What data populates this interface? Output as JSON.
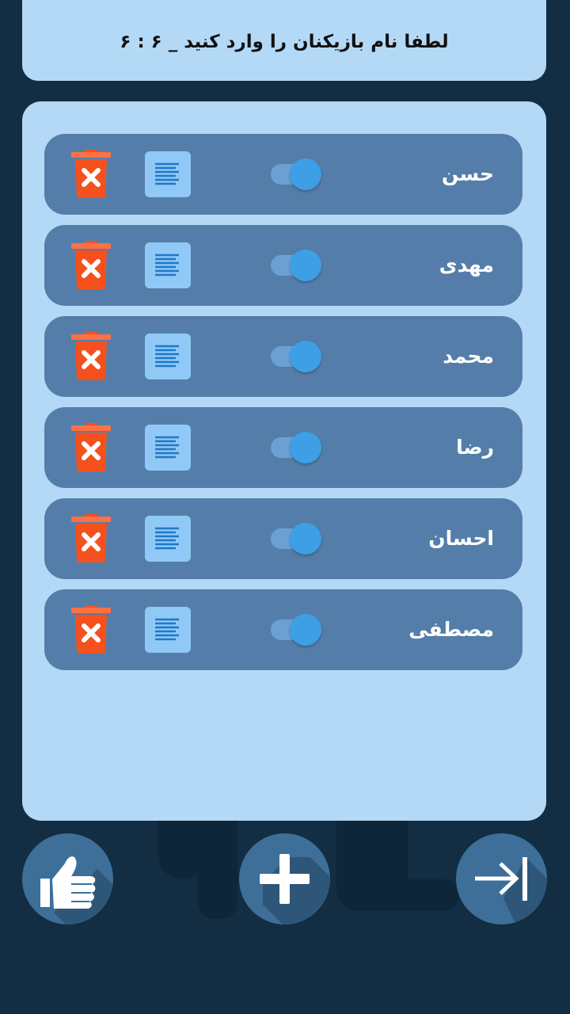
{
  "header": {
    "title": "لطفا نام بازیکنان را وارد کنید _ ۶ : ۶"
  },
  "players": [
    {
      "name": "حسن",
      "enabled": true
    },
    {
      "name": "مهدی",
      "enabled": true
    },
    {
      "name": "محمد",
      "enabled": true
    },
    {
      "name": "رضا",
      "enabled": true
    },
    {
      "name": "احسان",
      "enabled": true
    },
    {
      "name": "مصطفی",
      "enabled": true
    }
  ],
  "row_icons": {
    "toggle": "toggle-switch",
    "edit": "document-lines-icon",
    "delete": "trash-can-x-icon"
  },
  "bottom_bar": {
    "left": "thumbs-up-icon",
    "center": "plus-icon",
    "right": "arrow-to-bar-icon"
  },
  "colors": {
    "background": "#132d42",
    "card": "#b4d9f7",
    "row": "#547ea9",
    "toggle_knob": "#3e9ee6",
    "delete_red": "#f4511e",
    "round_button": "#3d6f98"
  }
}
